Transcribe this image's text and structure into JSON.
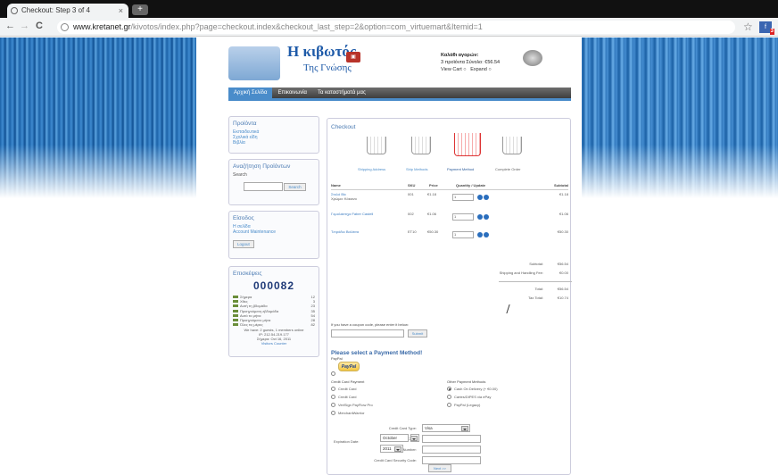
{
  "browser": {
    "tab_title": "Checkout: Step 3 of 4",
    "tab_close": "×",
    "new_tab": "+",
    "back": "←",
    "forward": "→",
    "reload": "C",
    "url_domain": "www.kretanet.gr",
    "url_path": "/kivotos/index.php?page=checkout.index&checkout_last_step=2&option=com_virtuemart&Itemid=1",
    "star": "☆",
    "ext_badge": "3"
  },
  "header": {
    "title": "Η κιβωτός",
    "subtitle": "Της Γνώσης",
    "cart_heading": "Καλάθι αγορών:",
    "cart_items": "3 προϊόντα    Σύνολο: €56.54",
    "view_cart": "View Cart",
    "expand": "Expand"
  },
  "menu": [
    "Αρχική Σελίδα",
    "Επικοινωνία",
    "Τα καταστήματά μας"
  ],
  "sidebar": {
    "products_title": "Προϊόντα",
    "products_items": [
      "Εκπαιδευτικά",
      "Σχολικά είδη",
      "Βιβλία"
    ],
    "search_title": "Αναζήτηση Προϊόντων",
    "search_label": "Search",
    "search_button": "Search",
    "login_title": "Είσοδος",
    "login_links": [
      "Η σελίδα",
      "Account Maintenance"
    ],
    "logout_button": "Logout",
    "visits_title": "Επισκέψεις",
    "counter": "000082",
    "visits": [
      {
        "label": "Σήμερα",
        "value": "12"
      },
      {
        "label": "Χθες",
        "value": "3"
      },
      {
        "label": "Αυτή τη βδομάδα",
        "value": "23"
      },
      {
        "label": "Προηγούμενη εβδομάδα",
        "value": "35"
      },
      {
        "label": "Αυτό το μήνα",
        "value": "54"
      },
      {
        "label": "Προηγούμενο μήνα",
        "value": "28"
      },
      {
        "label": "Όλες τις μέρες",
        "value": "82"
      }
    ],
    "visits_footer": [
      "We have: 2 guests, 1 members online",
      "IP: 212.54.219.177",
      "Σήμερα: Oct 16, 2011",
      "Visitors Counter"
    ]
  },
  "checkout": {
    "title": "Checkout",
    "steps": [
      "Shipping Address",
      "Ship Methods",
      "Payment Method",
      "Complete Order"
    ],
    "columns": [
      "Name",
      "SKU",
      "Price",
      "Quantity / Update",
      "Subtotal"
    ],
    "items": [
      {
        "name": "Στυλό Bic",
        "sub": "Χρώμα: Κόκκινο",
        "sku": "001",
        "price": "€1.18",
        "qty": "1",
        "subtotal": "€1.18"
      },
      {
        "name": "Γομολάστιχα Faber Castell",
        "sub": "",
        "sku": "002",
        "price": "€1.06",
        "qty": "1",
        "subtotal": "€1.06"
      },
      {
        "name": "Tετράδιο Βαλίτσα",
        "sub": "",
        "sku": "ET10",
        "price": "€50.30",
        "qty": "1",
        "subtotal": "€50.30"
      }
    ],
    "subtotal_label": "Subtotal:",
    "subtotal_value": "€56.54",
    "shipping_label": "Shipping and Handling Fee:",
    "shipping_value": "€0.00",
    "total_label": "Total:",
    "total_value": "€56.54",
    "tax_label": "Tax Total:",
    "tax_value": "€10.74",
    "coupon_text": "If you have a coupon code, please enter it below:",
    "coupon_button": "Submit",
    "payment_title": "Please select a Payment Method!",
    "paypal_label": "PayPal",
    "paypal_logo": "PayPal",
    "cc_group": "Credit Card Payment",
    "cc_options": [
      "Credit Card",
      "Credit Card",
      "VeriSign PayFlow Pro",
      "MerchantWarrior"
    ],
    "other_group": "Other Payment Methods",
    "other_options": [
      "Cash On Delivery (+ €0.00)",
      "Cartes/DIPES via ePay",
      "PayPal (Legacy)"
    ],
    "fields": {
      "card_type_label": "Credit Card Type:",
      "card_type_value": "Visa",
      "name_label": "Name On Card:",
      "number_label": "Credit Card Number:",
      "cvv_label": "Credit Card Security Code:",
      "exp_label": "Expiration Date:",
      "exp_month": "October",
      "exp_year": "2011"
    },
    "next_button": "Next >>"
  }
}
